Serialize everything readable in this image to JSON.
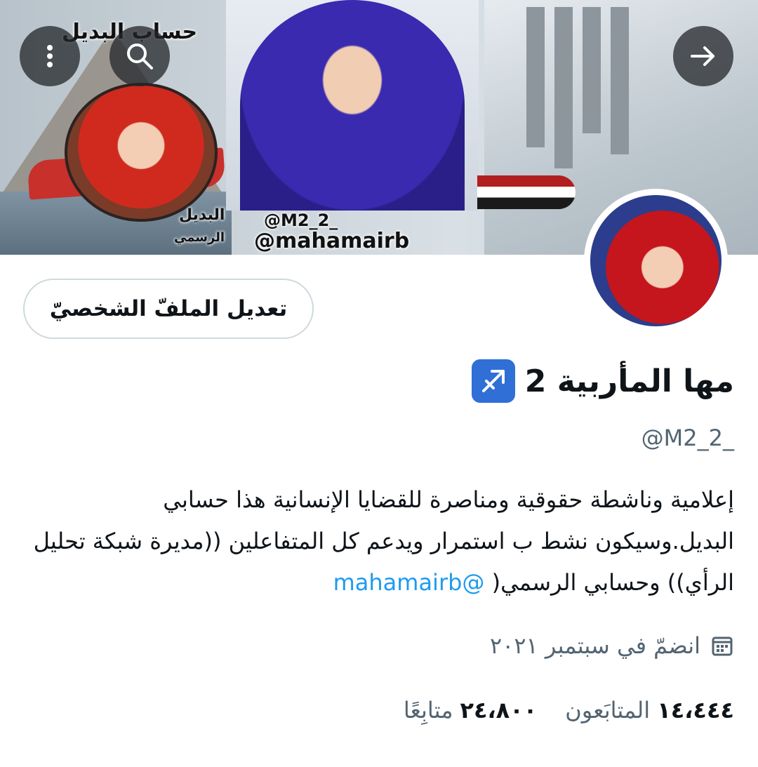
{
  "banner": {
    "title": "حساب البديل",
    "label_alt": "البديل",
    "label_official": "الرسمي",
    "handle_alt": "@M2_2_",
    "handle_official": "@mahamairb"
  },
  "toolbar": {
    "menu_icon": "more-vertical-icon",
    "search_icon": "search-icon",
    "forward_icon": "arrow-right-icon"
  },
  "profile": {
    "edit_button_label": "تعديل الملفّ الشخصيّ",
    "display_name": "مها المأربية 2",
    "badge_icon": "sagittarius-icon",
    "handle": "@M2_2_",
    "bio_text": "إعلامية وناشطة حقوقية ومناصرة للقضايا الإنسانية هذا حسابي البديل.وسيكون نشط ب استمرار ويدعم كل المتفاعلين ((مديرة شبكة تحليل الرأي)) وحسابي الرسمي( ",
    "bio_mention": "@mahamairb",
    "joined_text": "انضمّ في سبتمبر ٢٠٢١",
    "followers_count": "١٤،٤٤٤",
    "followers_label": "المتابَعون",
    "following_count": "٢٤،٨٠٠",
    "following_label": "متابِعًا"
  },
  "colors": {
    "accent": "#1d9bf0",
    "secondary_text": "#536471",
    "badge": "#2f6fd6"
  }
}
